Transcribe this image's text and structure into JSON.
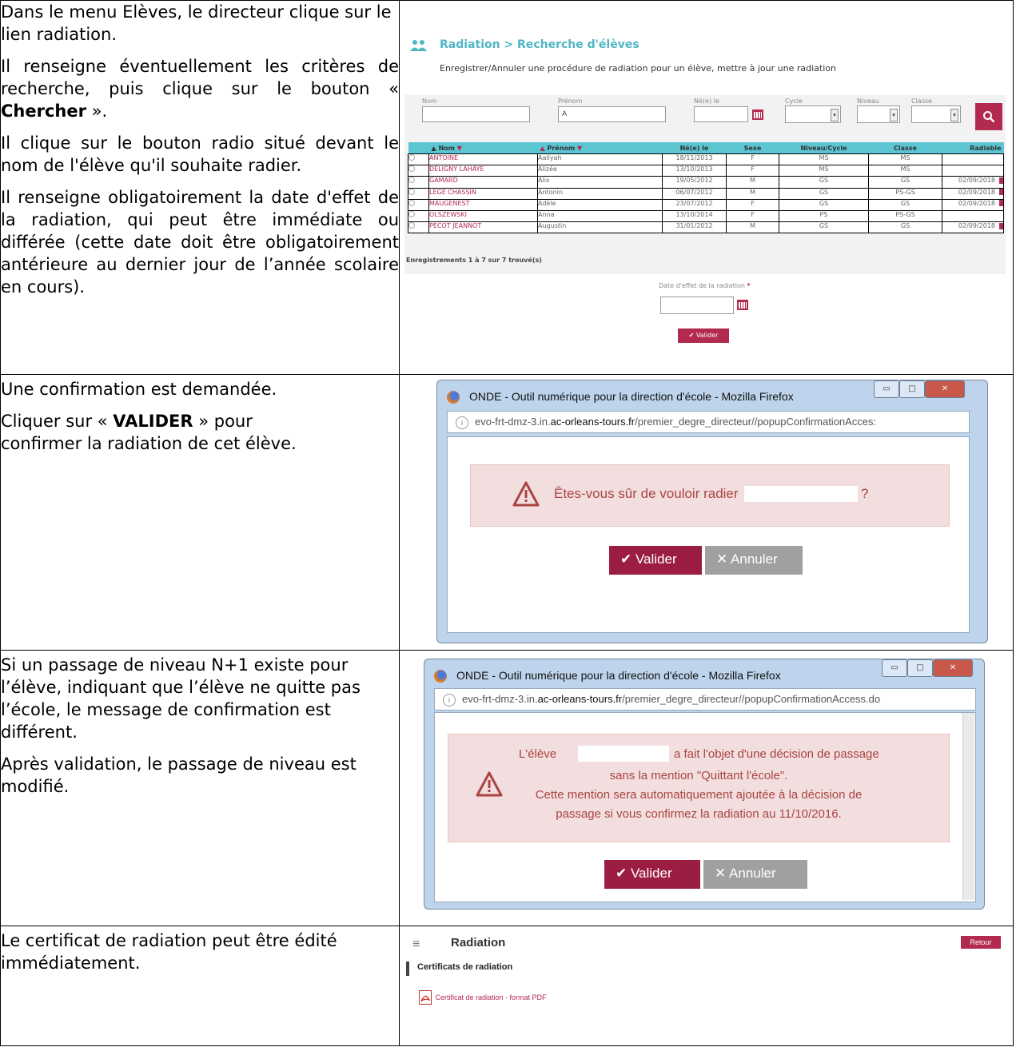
{
  "rows": [
    {
      "paragraphs": [
        "Dans le menu Elèves, le directeur clique sur le lien radiation.",
        "Il renseigne éventuellement les critères de recherche, puis clique sur le bouton «",
        "Il clique sur le bouton radio situé devant le nom de l'élève qu'il souhaite radier.",
        "Il renseigne obligatoirement la date d'effet de la radiation, qui peut être immédiate ou différée (cette date doit être obligatoirement antérieure au dernier jour de l’année scolaire en cours)."
      ],
      "p2_bold": "Chercher",
      "p2_end": "».",
      "screen": {
        "title": "Radiation > Recherche d'élèves",
        "subtitle": "Enregistrer/Annuler une procédure de radiation pour un élève, mettre à jour une radiation",
        "filters": {
          "nom_label": "Nom",
          "prenom_label": "Prénom",
          "prenom_value": "A",
          "ne_label": "Né(e) le",
          "cycle_label": "Cycle",
          "niveau_label": "Niveau",
          "classe_label": "Classe"
        },
        "columns": [
          "Nom",
          "Prénom",
          "Né(e) le",
          "Sexe",
          "Niveau/Cycle",
          "Classe",
          "Radiable"
        ],
        "rows": [
          {
            "nom": "ANTOINE",
            "prenom": "Aaliyah",
            "ne": "18/11/2013",
            "sexe": "F",
            "niveau": "MS",
            "classe": "MS",
            "radiable": ""
          },
          {
            "nom": "DELIGNY LAHAYE",
            "prenom": "Alizée",
            "ne": "13/10/2013",
            "sexe": "F",
            "niveau": "MS",
            "classe": "MS",
            "radiable": ""
          },
          {
            "nom": "GAMARD",
            "prenom": "Alix",
            "ne": "19/05/2012",
            "sexe": "M",
            "niveau": "GS",
            "classe": "GS",
            "radiable": "02/09/2018"
          },
          {
            "nom": "LEGÉ CHASSIN",
            "prenom": "Antonin",
            "ne": "06/07/2012",
            "sexe": "M",
            "niveau": "GS",
            "classe": "PS-GS",
            "radiable": "02/09/2018"
          },
          {
            "nom": "MAUGENEST",
            "prenom": "Adèle",
            "ne": "23/07/2012",
            "sexe": "F",
            "niveau": "GS",
            "classe": "GS",
            "radiable": "02/09/2018"
          },
          {
            "nom": "OLSZEWSKI",
            "prenom": "Anna",
            "ne": "13/10/2014",
            "sexe": "F",
            "niveau": "PS",
            "classe": "PS-GS",
            "radiable": ""
          },
          {
            "nom": "PÉCOT JEANNOT",
            "prenom": "Augustin",
            "ne": "31/01/2012",
            "sexe": "M",
            "niveau": "GS",
            "classe": "GS",
            "radiable": "02/09/2018"
          }
        ],
        "records": "Enregistrements 1 à 7 sur 7 trouvé(s)",
        "date_label": "Date d'effet de la radiation",
        "required_mark": "*",
        "valider": "Valider"
      }
    },
    {
      "paragraphs": [
        "Une confirmation est demandée.",
        "Cliquer sur «",
        "confirmer la radiation de cet élève."
      ],
      "p2_bold": "VALIDER",
      "p2_end": "» pour",
      "window_title": "ONDE - Outil numérique pour la direction d'école - Mozilla Firefox",
      "url_prefix": "evo-frt-dmz-3.in.",
      "url_domain": "ac-orleans-tours.fr",
      "url_path": "/premier_degre_directeur//popupConfirmationAcces:",
      "message": "Êtes-vous sûr de vouloir radier",
      "message_end": "?",
      "valider": "Valider",
      "annuler": "Annuler"
    },
    {
      "paragraphs": [
        "Si un passage de niveau N+1 existe pour l’élève, indiquant que l’élève ne quitte pas l’école, le message de confirmation est différent.",
        "Après validation, le passage de niveau est modifié."
      ],
      "window_title": "ONDE - Outil numérique pour la direction d'école - Mozilla Firefox",
      "url_prefix": "evo-frt-dmz-3.in.",
      "url_domain": "ac-orleans-tours.fr",
      "url_path": "/premier_degre_directeur//popupConfirmationAccess.do",
      "message_lines": [
        "L'élève",
        "a fait l'objet d'une décision de passage",
        "sans la mention \"Quittant l'école\".",
        "Cette mention sera automatiquement ajoutée à la décision de",
        "passage si vous confirmez la radiation au 11/10/2016."
      ],
      "valider": "Valider",
      "annuler": "Annuler"
    },
    {
      "paragraphs": [
        "Le certificat de radiation peut être édité immédiatement."
      ],
      "title": "Radiation",
      "retour": "Retour",
      "section": "Certificats de radiation",
      "link": "Certificat de radiation - format PDF"
    }
  ],
  "colors": {
    "brand": "#b22a4f",
    "accent": "#5bc5d1",
    "alert_bg": "#f2dede",
    "alert_text": "#a94442"
  }
}
